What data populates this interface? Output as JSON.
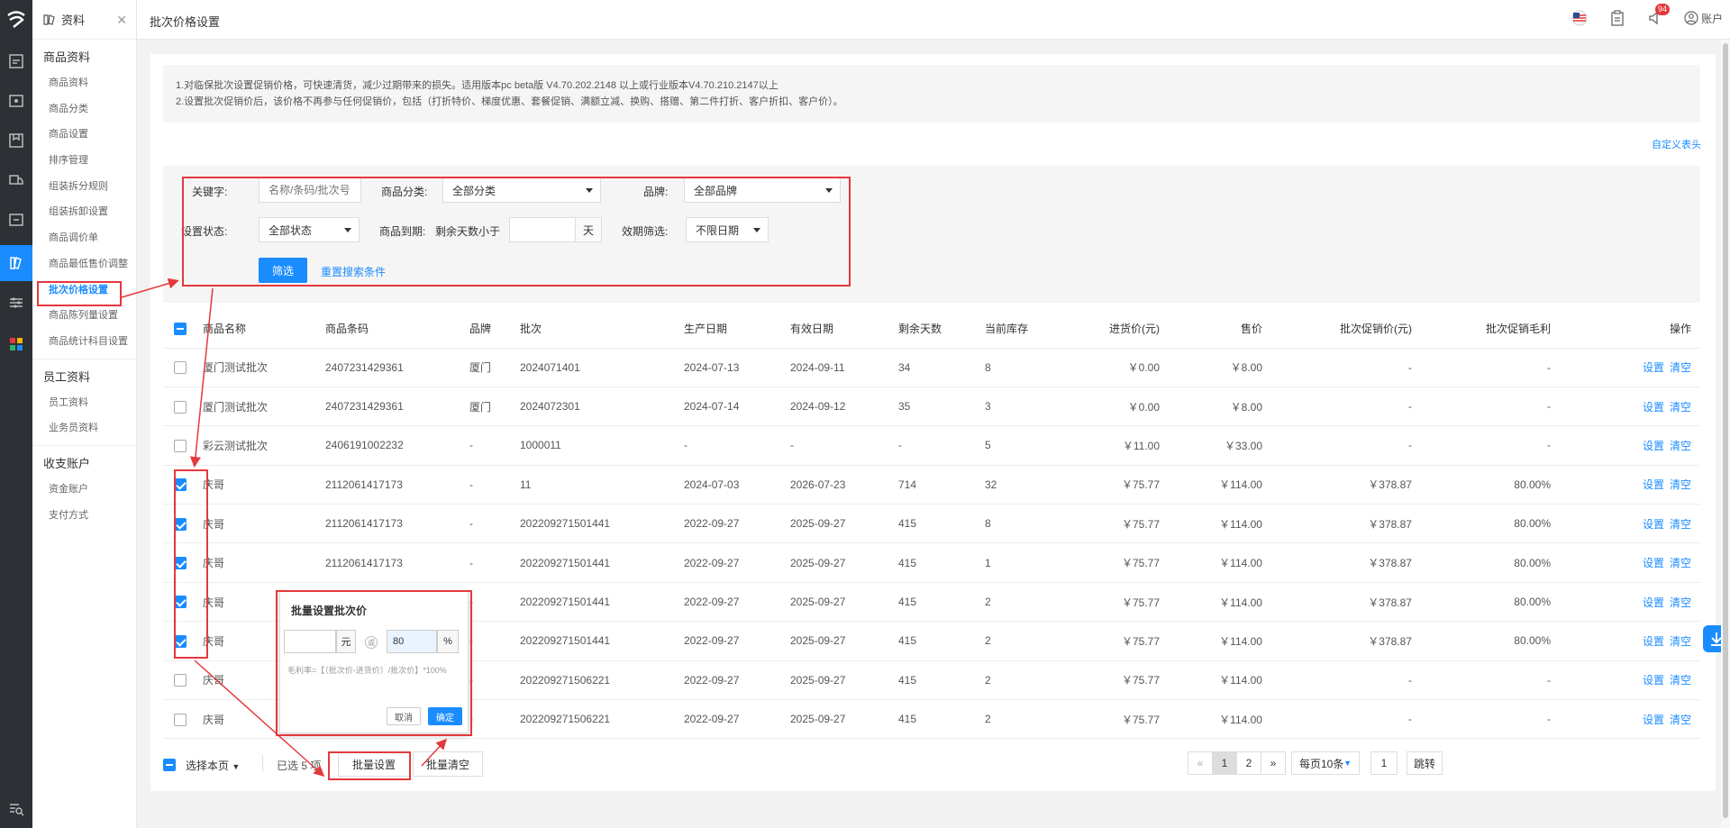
{
  "sidebar": {
    "title": "资料",
    "groups": [
      {
        "label": "商品资料",
        "items": [
          "商品资料",
          "商品分类",
          "商品设置",
          "排序管理",
          "组装拆分规则",
          "组装拆卸设置",
          "商品调价单",
          "商品最低售价调整",
          "批次价格设置",
          "商品陈列量设置",
          "商品统计科目设置"
        ]
      },
      {
        "label": "员工资料",
        "items": [
          "员工资料",
          "业务员资料"
        ]
      },
      {
        "label": "收支账户",
        "items": [
          "资金账户",
          "支付方式"
        ]
      }
    ],
    "active_item": "批次价格设置"
  },
  "topbar": {
    "page_title": "批次价格设置",
    "notification_badge": "94",
    "account_label": "账户"
  },
  "notice": {
    "line1": "1.对临保批次设置促销价格，可快速清货，减少过期带来的损失。适用版本pc beta版 V4.70.202.2148 以上或行业版本V4.70.210.2147以上",
    "line2": "2.设置批次促销价后，该价格不再参与任何促销价，包括（打折特价、梯度优惠、套餐促销、满额立减、换购、搭赠、第二件打折、客户折扣、客户价）。"
  },
  "custom_header_link": "自定义表头",
  "filter": {
    "keyword_label": "关键字:",
    "keyword_placeholder": "名称/条码/批次号",
    "category_label": "商品分类:",
    "category_value": "全部分类",
    "brand_label": "品牌:",
    "brand_value": "全部品牌",
    "status_label": "设置状态:",
    "status_value": "全部状态",
    "expiry_label": "商品到期:",
    "remaining_label": "剩余天数小于",
    "day_unit": "天",
    "validity_label": "效期筛选:",
    "validity_value": "不限日期",
    "filter_button": "筛选",
    "reset_link": "重置搜索条件"
  },
  "table": {
    "headers": [
      "商品名称",
      "商品条码",
      "品牌",
      "批次",
      "生产日期",
      "有效日期",
      "剩余天数",
      "当前库存",
      "进货价(元)",
      "售价",
      "批次促销价(元)",
      "批次促销毛利",
      "操作"
    ],
    "op_set": "设置",
    "op_clear": "清空",
    "rows": [
      {
        "checked": false,
        "name": "厦门测试批次",
        "barcode": "2407231429361",
        "brand": "厦门",
        "batch": "2024071401",
        "prod": "2024-07-13",
        "exp": "2024-09-11",
        "days": "34",
        "stock": "8",
        "cost": "￥0.00",
        "price": "￥8.00",
        "promo": "-",
        "margin": "-"
      },
      {
        "checked": false,
        "name": "厦门测试批次",
        "barcode": "2407231429361",
        "brand": "厦门",
        "batch": "2024072301",
        "prod": "2024-07-14",
        "exp": "2024-09-12",
        "days": "35",
        "stock": "3",
        "cost": "￥0.00",
        "price": "￥8.00",
        "promo": "-",
        "margin": "-"
      },
      {
        "checked": false,
        "name": "彩云测试批次",
        "barcode": "2406191002232",
        "brand": "-",
        "batch": "1000011",
        "prod": "-",
        "exp": "-",
        "days": "-",
        "stock": "5",
        "cost": "￥11.00",
        "price": "￥33.00",
        "promo": "-",
        "margin": "-"
      },
      {
        "checked": true,
        "name": "庆哥",
        "barcode": "2112061417173",
        "brand": "-",
        "batch": "11",
        "prod": "2024-07-03",
        "exp": "2026-07-23",
        "days": "714",
        "stock": "32",
        "cost": "￥75.77",
        "price": "￥114.00",
        "promo": "￥378.87",
        "margin": "80.00%"
      },
      {
        "checked": true,
        "name": "庆哥",
        "barcode": "2112061417173",
        "brand": "-",
        "batch": "202209271501441",
        "prod": "2022-09-27",
        "exp": "2025-09-27",
        "days": "415",
        "stock": "8",
        "cost": "￥75.77",
        "price": "￥114.00",
        "promo": "￥378.87",
        "margin": "80.00%"
      },
      {
        "checked": true,
        "name": "庆哥",
        "barcode": "2112061417173",
        "brand": "-",
        "batch": "202209271501441",
        "prod": "2022-09-27",
        "exp": "2025-09-27",
        "days": "415",
        "stock": "1",
        "cost": "￥75.77",
        "price": "￥114.00",
        "promo": "￥378.87",
        "margin": "80.00%"
      },
      {
        "checked": true,
        "name": "庆哥",
        "barcode": "",
        "brand": "-",
        "batch": "202209271501441",
        "prod": "2022-09-27",
        "exp": "2025-09-27",
        "days": "415",
        "stock": "2",
        "cost": "￥75.77",
        "price": "￥114.00",
        "promo": "￥378.87",
        "margin": "80.00%"
      },
      {
        "checked": true,
        "name": "庆哥",
        "barcode": "",
        "brand": "-",
        "batch": "202209271501441",
        "prod": "2022-09-27",
        "exp": "2025-09-27",
        "days": "415",
        "stock": "2",
        "cost": "￥75.77",
        "price": "￥114.00",
        "promo": "￥378.87",
        "margin": "80.00%"
      },
      {
        "checked": false,
        "name": "庆哥",
        "barcode": "",
        "brand": "-",
        "batch": "202209271506221",
        "prod": "2022-09-27",
        "exp": "2025-09-27",
        "days": "415",
        "stock": "2",
        "cost": "￥75.77",
        "price": "￥114.00",
        "promo": "-",
        "margin": "-"
      },
      {
        "checked": false,
        "name": "庆哥",
        "barcode": "",
        "brand": "-",
        "batch": "202209271506221",
        "prod": "2022-09-27",
        "exp": "2025-09-27",
        "days": "415",
        "stock": "2",
        "cost": "￥75.77",
        "price": "￥114.00",
        "promo": "-",
        "margin": "-"
      }
    ]
  },
  "footer": {
    "select_page": "选择本页",
    "selected_text": "已选 5 项",
    "batch_set": "批量设置",
    "batch_clear": "批量清空",
    "pages": [
      "«",
      "1",
      "2",
      "»"
    ],
    "current_page": "1",
    "page_size": "每页10条",
    "jump_value": "1",
    "jump_button": "跳转"
  },
  "popup": {
    "title": "批量设置批次价",
    "yuan_unit": "元",
    "or_symbol": "或",
    "percent_value": "80",
    "percent_unit": "%",
    "formula": "毛利率=【（批次价-进货价）/批次价】*100%",
    "cancel": "取消",
    "confirm": "确定"
  },
  "colors": {
    "accent": "#1a8cff",
    "annotation_red": "#e4393c",
    "rail": "#2d3035"
  }
}
